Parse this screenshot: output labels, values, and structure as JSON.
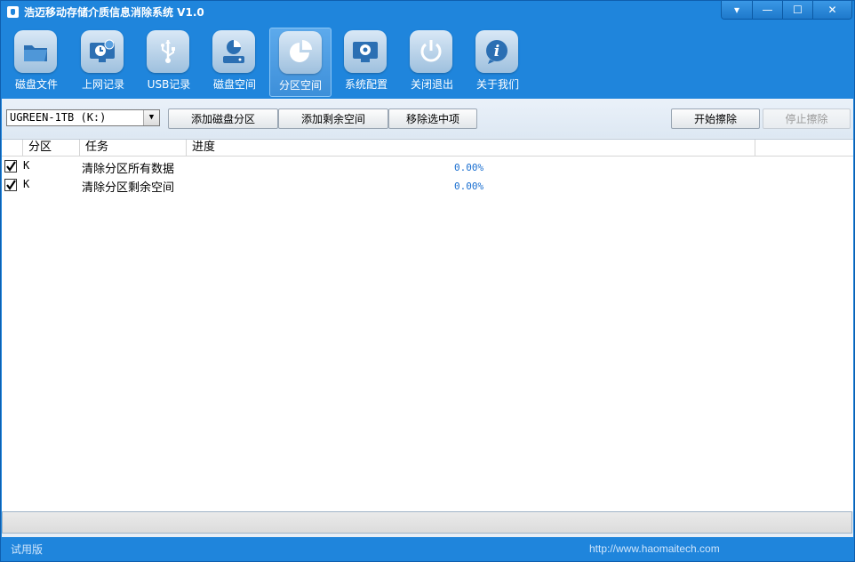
{
  "window": {
    "title": "浩迈移动存储介质信息消除系统 V1.0",
    "controls": {
      "menu": "▾",
      "minimize": "—",
      "maximize": "☐",
      "close": "✕"
    }
  },
  "toolbar": {
    "items": [
      {
        "label": "磁盘文件",
        "icon": "folder-icon"
      },
      {
        "label": "上网记录",
        "icon": "browser-history-icon"
      },
      {
        "label": "USB记录",
        "icon": "usb-icon"
      },
      {
        "label": "磁盘空间",
        "icon": "disk-space-icon"
      },
      {
        "label": "分区空间",
        "icon": "pie-chart-icon",
        "active": true
      },
      {
        "label": "系统配置",
        "icon": "gear-icon"
      },
      {
        "label": "关闭退出",
        "icon": "power-icon"
      },
      {
        "label": "关于我们",
        "icon": "info-icon"
      }
    ]
  },
  "controls": {
    "drive_select": "UGREEN-1TB (K:)",
    "add_partition": "添加磁盘分区",
    "add_free_space": "添加剩余空间",
    "remove_selected": "移除选中项",
    "start_wipe": "开始擦除",
    "stop_wipe": "停止擦除"
  },
  "list": {
    "columns": [
      "分区",
      "任务",
      "进度"
    ],
    "rows": [
      {
        "checked": true,
        "partition": "K",
        "task": "清除分区所有数据",
        "progress": "0.00%"
      },
      {
        "checked": true,
        "partition": "K",
        "task": "清除分区剩余空间",
        "progress": "0.00%"
      }
    ]
  },
  "status": {
    "edition": "试用版",
    "url": "http://www.haomaitech.com"
  },
  "colors": {
    "chrome_blue": "#1f85dc",
    "progress_text": "#1a6fd0"
  }
}
